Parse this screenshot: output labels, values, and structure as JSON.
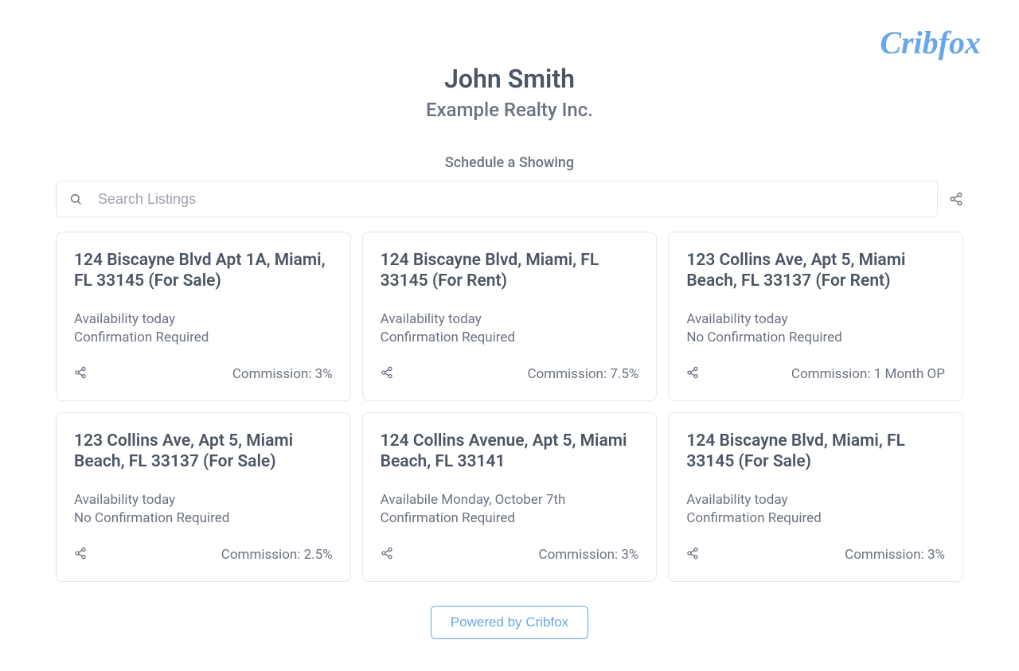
{
  "brand": "Cribfox",
  "header": {
    "agent_name": "John Smith",
    "agency_name": "Example Realty Inc.",
    "schedule_label": "Schedule a Showing"
  },
  "search": {
    "placeholder": "Search Listings",
    "value": ""
  },
  "commission_prefix": "Commission: ",
  "listings": [
    {
      "title": "124 Biscayne Blvd Apt 1A, Miami, FL 33145 (For Sale)",
      "availability": "Availability today",
      "confirmation": "Confirmation Required",
      "commission": "3%"
    },
    {
      "title": "124 Biscayne Blvd, Miami, FL 33145 (For Rent)",
      "availability": "Availability today",
      "confirmation": "Confirmation Required",
      "commission": "7.5%"
    },
    {
      "title": "123 Collins Ave, Apt 5, Miami Beach, FL 33137 (For Rent)",
      "availability": "Availability today",
      "confirmation": "No Confirmation Required",
      "commission": "1 Month OP"
    },
    {
      "title": "123 Collins Ave, Apt 5, Miami Beach, FL 33137 (For Sale)",
      "availability": "Availability today",
      "confirmation": "No Confirmation Required",
      "commission": "2.5%"
    },
    {
      "title": "124 Collins Avenue, Apt 5, Miami Beach, FL 33141",
      "availability": "Availabile Monday, October 7th",
      "confirmation": "Confirmation Required",
      "commission": "3%"
    },
    {
      "title": "124 Biscayne Blvd, Miami, FL 33145 (For Sale)",
      "availability": "Availability today",
      "confirmation": "Confirmation Required",
      "commission": "3%"
    }
  ],
  "footer": {
    "powered_label": "Powered by Cribfox"
  }
}
